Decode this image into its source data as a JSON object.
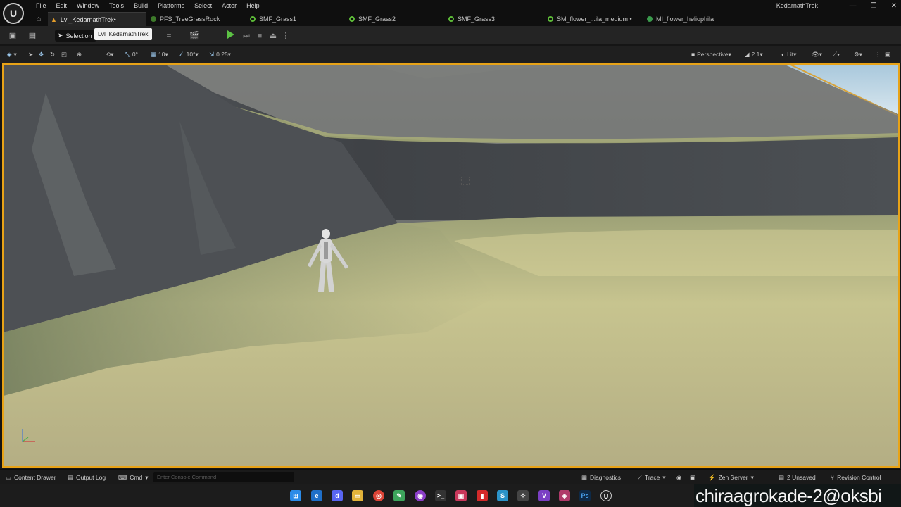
{
  "app": {
    "logo": "unreal-engine-logo",
    "window_title": "KedarnathTrek",
    "window_controls": [
      "—",
      "❐",
      "✕"
    ]
  },
  "menu": [
    "File",
    "Edit",
    "Window",
    "Tools",
    "Build",
    "Platforms",
    "Select",
    "Actor",
    "Help"
  ],
  "tabs": [
    {
      "label": "Lvl_KedarnathTrek•",
      "icon": "level-icon",
      "active": true
    },
    {
      "label": "PFS_TreeGrassRock",
      "icon": "foliage-icon",
      "active": false
    },
    {
      "label": "SMF_Grass1",
      "icon": "static-mesh-icon",
      "active": false
    },
    {
      "label": "SMF_Grass2",
      "icon": "static-mesh-icon",
      "active": false
    },
    {
      "label": "SMF_Grass3",
      "icon": "static-mesh-icon",
      "active": false
    },
    {
      "label": "SM_flower_...ila_medium •",
      "icon": "static-mesh-icon",
      "active": false
    },
    {
      "label": "MI_flower_heliophila",
      "icon": "material-instance-icon",
      "active": false
    }
  ],
  "toolbar": {
    "selection_label": "Selection",
    "tooltip": "Lvl_KedarnathTrek"
  },
  "viewport_toolbar": {
    "rotation_snap": "0°",
    "grid_snap": "10",
    "angle_snap": "10°",
    "scale_snap": "0.25",
    "view_mode_label": "Perspective",
    "fov": "2.1",
    "lighting_label": "Lit"
  },
  "statusbar": {
    "content_drawer": "Content Drawer",
    "output_log": "Output Log",
    "cmd": "Cmd",
    "console_placeholder": "Enter Console Command",
    "diagnostics": "Diagnostics",
    "trace": "Trace",
    "zen_server": "Zen Server",
    "unsaved": "2 Unsaved",
    "revision_control": "Revision Control"
  },
  "taskbar": {
    "apps": [
      "windows-start",
      "edge-icon",
      "discord-icon",
      "file-explorer-icon",
      "chrome-icon",
      "notepad-icon",
      "github-icon",
      "terminal-icon",
      "photos-icon",
      "red-app-icon",
      "sourcetree-icon",
      "copilot-icon",
      "visual-studio-icon",
      "davinci-icon",
      "photoshop-icon",
      "unreal-engine-icon"
    ]
  },
  "watermark": "chiraagrokade-2@oksbi",
  "colors": {
    "viewport_border": "#e8a317",
    "play_green": "#5cc244",
    "level_icon": "#e39c2a",
    "sky": "#b8d4e6",
    "cliff": "#4a4d52",
    "grass": "#c8c48c"
  }
}
